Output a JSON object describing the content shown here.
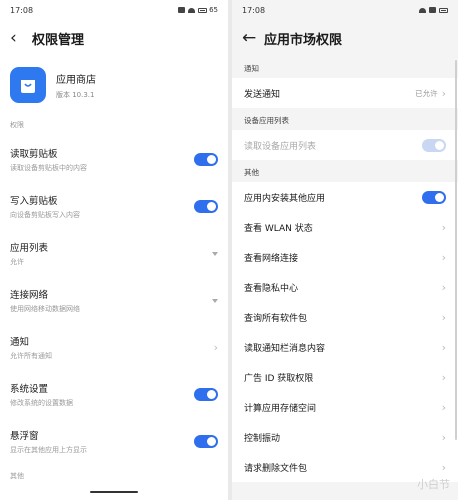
{
  "left": {
    "status": {
      "time": "17:08",
      "battery": "65"
    },
    "title": "权限管理",
    "app": {
      "name": "应用商店",
      "version": "版本 10.3.1"
    },
    "section": "权限",
    "items": [
      {
        "label": "读取剪贴板",
        "sub": "读取设备剪贴板中的内容",
        "control": "toggle"
      },
      {
        "label": "写入剪贴板",
        "sub": "向设备剪贴板写入内容",
        "control": "toggle"
      },
      {
        "label": "应用列表",
        "sub": "允许",
        "control": "dropdown"
      },
      {
        "label": "连接网络",
        "sub": "使用网络移动数据网络",
        "control": "dropdown"
      },
      {
        "label": "通知",
        "sub": "允许所有通知",
        "control": "chevron"
      },
      {
        "label": "系统设置",
        "sub": "修改系统的设置数据",
        "control": "toggle"
      },
      {
        "label": "悬浮窗",
        "sub": "显示在其他应用上方显示",
        "control": "toggle"
      }
    ],
    "bottom_section": "其他"
  },
  "right": {
    "status": {
      "time": "17:08"
    },
    "title": "应用市场权限",
    "notify": {
      "section": "通知",
      "label": "发送通知",
      "value": "已允许"
    },
    "device": {
      "section": "设备应用列表",
      "label": "读取设备应用列表"
    },
    "other": {
      "section": "其他",
      "install_label": "应用内安装其他应用",
      "items": [
        "查看 WLAN 状态",
        "查看网络连接",
        "查看隐私中心",
        "查询所有软件包",
        "读取通知栏消息内容",
        "广告 ID 获取权限",
        "计算应用存储空间",
        "控制振动",
        "请求删除文件包"
      ]
    },
    "watermark": "小白节"
  },
  "icons": {
    "back": "back-arrow-icon",
    "app": "shopping-bag-icon",
    "chevron": "chevron-right-icon"
  },
  "colors": {
    "accent": "#2f6fed",
    "app_icon": "#2f79f0"
  }
}
